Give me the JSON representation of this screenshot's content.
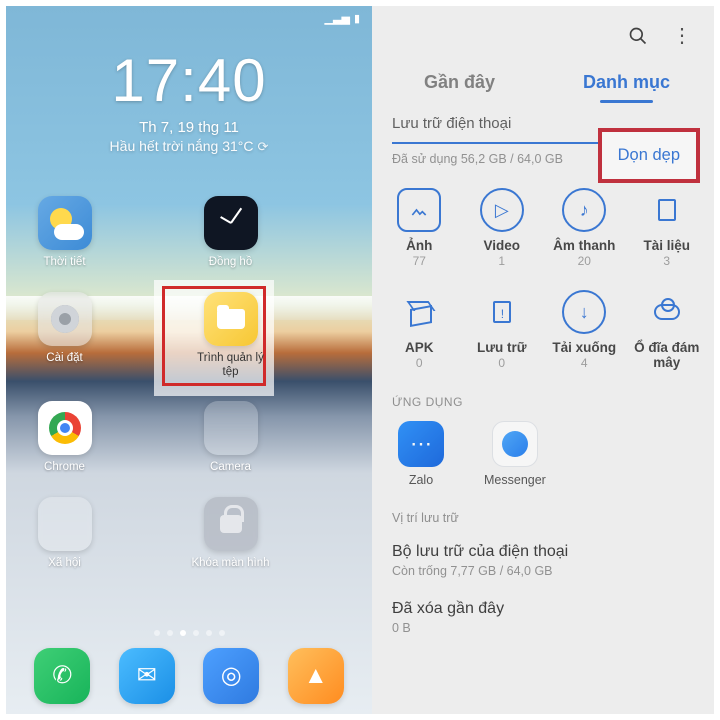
{
  "left": {
    "clock": {
      "time": "17:40",
      "date": "Th 7, 19 thg 11",
      "weather": "Hầu hết trời nắng 31°C"
    },
    "apps": {
      "weather": "Thời tiết",
      "clock": "Đồng hồ",
      "filemgr": "Trình quản lý tệp",
      "settings": "Cài đặt",
      "chrome": "Chrome",
      "camera": "Camera",
      "social": "Xã hội",
      "lock": "Khóa màn hình"
    }
  },
  "right": {
    "tabs": {
      "recent": "Gần đây",
      "categories": "Danh mục"
    },
    "storage_title": "Lưu trữ điện thoại",
    "storage_used": "Đã sử dụng 56,2 GB / 64,0 GB",
    "cleanup": "Dọn dẹp",
    "cats": [
      {
        "label": "Ảnh",
        "count": "77"
      },
      {
        "label": "Video",
        "count": "1"
      },
      {
        "label": "Âm thanh",
        "count": "20"
      },
      {
        "label": "Tài liệu",
        "count": "3"
      },
      {
        "label": "APK",
        "count": "0"
      },
      {
        "label": "Lưu trữ",
        "count": "0"
      },
      {
        "label": "Tải xuống",
        "count": "4"
      },
      {
        "label": "Ổ đĩa đám mây",
        "count": ""
      }
    ],
    "apps_header": "ỨNG DỤNG",
    "apps": {
      "zalo": "Zalo",
      "messenger": "Messenger"
    },
    "loc_header": "Vị trí lưu trữ",
    "list": [
      {
        "title": "Bộ lưu trữ của điện thoại",
        "sub": "Còn trống 7,77 GB / 64,0 GB"
      },
      {
        "title": "Đã xóa gần đây",
        "sub": "0 B"
      }
    ]
  }
}
